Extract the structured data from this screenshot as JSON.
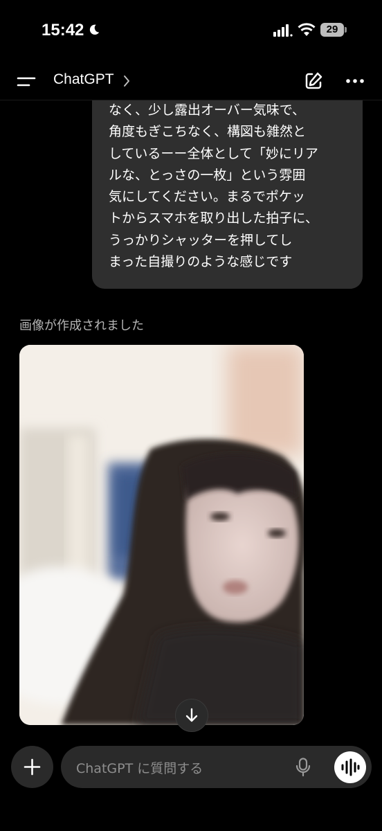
{
  "status_bar": {
    "time": "15:42",
    "battery": "29"
  },
  "header": {
    "title": "ChatGPT",
    "menu_icon": "menu-icon",
    "edit_icon": "edit-icon",
    "more_icon": "more-icon"
  },
  "conversation": {
    "user_message": "なく、少し露出オーバー気味で、\n角度もぎこちなく、構図も雑然と\nしているーー全体として「妙にリア\nルな、とっさの一枚」という雰囲\n気にしてください。まるでポケッ\nトからスマホを取り出した拍子に、\nうっかりシャッターを押してし\nまった自撮りのような感じです",
    "assistant_status": "画像が作成されました",
    "image_icon": "image-icon"
  },
  "composer": {
    "placeholder": "ChatGPT に質問する",
    "plus_icon": "plus-icon",
    "mic_icon": "mic-icon",
    "voice_icon": "voice-mode-icon"
  }
}
